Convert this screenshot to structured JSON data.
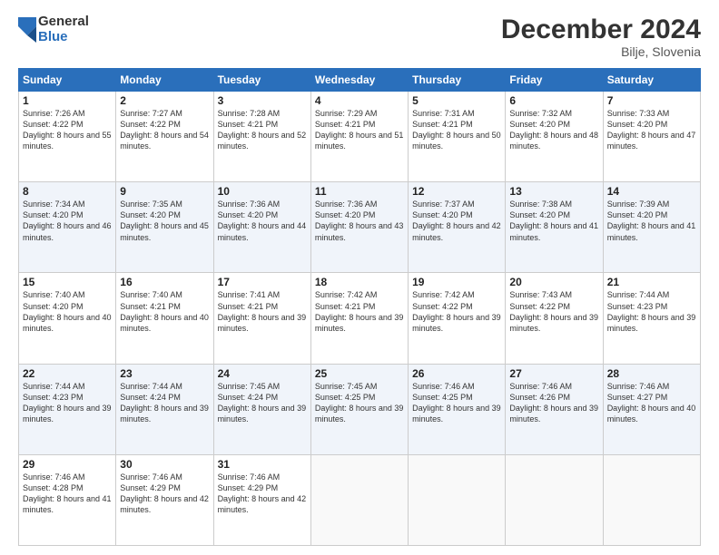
{
  "logo": {
    "general": "General",
    "blue": "Blue"
  },
  "title": "December 2024",
  "subtitle": "Bilje, Slovenia",
  "days_header": [
    "Sunday",
    "Monday",
    "Tuesday",
    "Wednesday",
    "Thursday",
    "Friday",
    "Saturday"
  ],
  "weeks": [
    [
      {
        "day": "1",
        "sunrise": "7:26 AM",
        "sunset": "4:22 PM",
        "daylight": "8 hours and 55 minutes."
      },
      {
        "day": "2",
        "sunrise": "7:27 AM",
        "sunset": "4:22 PM",
        "daylight": "8 hours and 54 minutes."
      },
      {
        "day": "3",
        "sunrise": "7:28 AM",
        "sunset": "4:21 PM",
        "daylight": "8 hours and 52 minutes."
      },
      {
        "day": "4",
        "sunrise": "7:29 AM",
        "sunset": "4:21 PM",
        "daylight": "8 hours and 51 minutes."
      },
      {
        "day": "5",
        "sunrise": "7:31 AM",
        "sunset": "4:21 PM",
        "daylight": "8 hours and 50 minutes."
      },
      {
        "day": "6",
        "sunrise": "7:32 AM",
        "sunset": "4:20 PM",
        "daylight": "8 hours and 48 minutes."
      },
      {
        "day": "7",
        "sunrise": "7:33 AM",
        "sunset": "4:20 PM",
        "daylight": "8 hours and 47 minutes."
      }
    ],
    [
      {
        "day": "8",
        "sunrise": "7:34 AM",
        "sunset": "4:20 PM",
        "daylight": "8 hours and 46 minutes."
      },
      {
        "day": "9",
        "sunrise": "7:35 AM",
        "sunset": "4:20 PM",
        "daylight": "8 hours and 45 minutes."
      },
      {
        "day": "10",
        "sunrise": "7:36 AM",
        "sunset": "4:20 PM",
        "daylight": "8 hours and 44 minutes."
      },
      {
        "day": "11",
        "sunrise": "7:36 AM",
        "sunset": "4:20 PM",
        "daylight": "8 hours and 43 minutes."
      },
      {
        "day": "12",
        "sunrise": "7:37 AM",
        "sunset": "4:20 PM",
        "daylight": "8 hours and 42 minutes."
      },
      {
        "day": "13",
        "sunrise": "7:38 AM",
        "sunset": "4:20 PM",
        "daylight": "8 hours and 41 minutes."
      },
      {
        "day": "14",
        "sunrise": "7:39 AM",
        "sunset": "4:20 PM",
        "daylight": "8 hours and 41 minutes."
      }
    ],
    [
      {
        "day": "15",
        "sunrise": "7:40 AM",
        "sunset": "4:20 PM",
        "daylight": "8 hours and 40 minutes."
      },
      {
        "day": "16",
        "sunrise": "7:40 AM",
        "sunset": "4:21 PM",
        "daylight": "8 hours and 40 minutes."
      },
      {
        "day": "17",
        "sunrise": "7:41 AM",
        "sunset": "4:21 PM",
        "daylight": "8 hours and 39 minutes."
      },
      {
        "day": "18",
        "sunrise": "7:42 AM",
        "sunset": "4:21 PM",
        "daylight": "8 hours and 39 minutes."
      },
      {
        "day": "19",
        "sunrise": "7:42 AM",
        "sunset": "4:22 PM",
        "daylight": "8 hours and 39 minutes."
      },
      {
        "day": "20",
        "sunrise": "7:43 AM",
        "sunset": "4:22 PM",
        "daylight": "8 hours and 39 minutes."
      },
      {
        "day": "21",
        "sunrise": "7:44 AM",
        "sunset": "4:23 PM",
        "daylight": "8 hours and 39 minutes."
      }
    ],
    [
      {
        "day": "22",
        "sunrise": "7:44 AM",
        "sunset": "4:23 PM",
        "daylight": "8 hours and 39 minutes."
      },
      {
        "day": "23",
        "sunrise": "7:44 AM",
        "sunset": "4:24 PM",
        "daylight": "8 hours and 39 minutes."
      },
      {
        "day": "24",
        "sunrise": "7:45 AM",
        "sunset": "4:24 PM",
        "daylight": "8 hours and 39 minutes."
      },
      {
        "day": "25",
        "sunrise": "7:45 AM",
        "sunset": "4:25 PM",
        "daylight": "8 hours and 39 minutes."
      },
      {
        "day": "26",
        "sunrise": "7:46 AM",
        "sunset": "4:25 PM",
        "daylight": "8 hours and 39 minutes."
      },
      {
        "day": "27",
        "sunrise": "7:46 AM",
        "sunset": "4:26 PM",
        "daylight": "8 hours and 39 minutes."
      },
      {
        "day": "28",
        "sunrise": "7:46 AM",
        "sunset": "4:27 PM",
        "daylight": "8 hours and 40 minutes."
      }
    ],
    [
      {
        "day": "29",
        "sunrise": "7:46 AM",
        "sunset": "4:28 PM",
        "daylight": "8 hours and 41 minutes."
      },
      {
        "day": "30",
        "sunrise": "7:46 AM",
        "sunset": "4:29 PM",
        "daylight": "8 hours and 42 minutes."
      },
      {
        "day": "31",
        "sunrise": "7:46 AM",
        "sunset": "4:29 PM",
        "daylight": "8 hours and 42 minutes."
      },
      null,
      null,
      null,
      null
    ]
  ]
}
